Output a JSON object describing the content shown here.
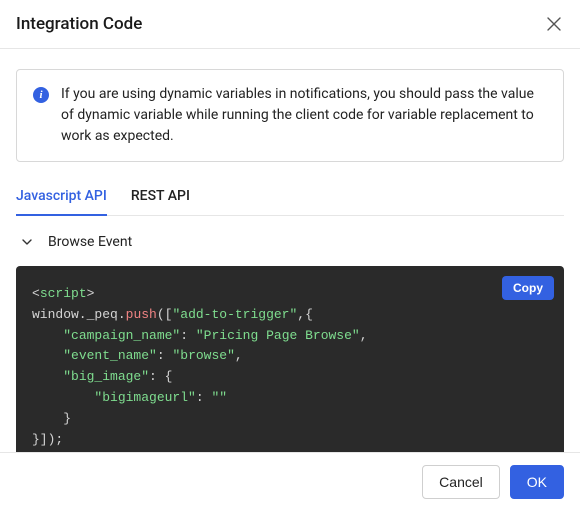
{
  "header": {
    "title": "Integration Code"
  },
  "info": {
    "text": "If you are using dynamic variables in notifications, you should pass the value of dynamic variable while running the client code for variable replacement to work as expected."
  },
  "tabs": [
    {
      "label": "Javascript API",
      "active": true
    },
    {
      "label": "REST API",
      "active": false
    }
  ],
  "accordion": {
    "title": "Browse Event"
  },
  "code": {
    "copy_label": "Copy",
    "tokens": {
      "lt": "<",
      "script_tag": "script",
      "gt": ">",
      "window_peq": "window._peq",
      "dot": ".",
      "push": "push",
      "open_call": "([",
      "add_trigger": "\"add-to-trigger\"",
      "comma_brace": ",{",
      "campaign_key": "\"campaign_name\"",
      "colon": ":",
      "campaign_val": "\"Pricing Page Browse\"",
      "comma": ",",
      "event_key": "\"event_name\"",
      "event_val": "\"browse\"",
      "bigimg_key": "\"big_image\"",
      "open_brace": "{",
      "bigurl_key": "\"bigimageurl\"",
      "bigurl_val": "\"\"",
      "close_brace": "}",
      "close_all": "}]);"
    }
  },
  "footer": {
    "cancel": "Cancel",
    "ok": "OK"
  }
}
